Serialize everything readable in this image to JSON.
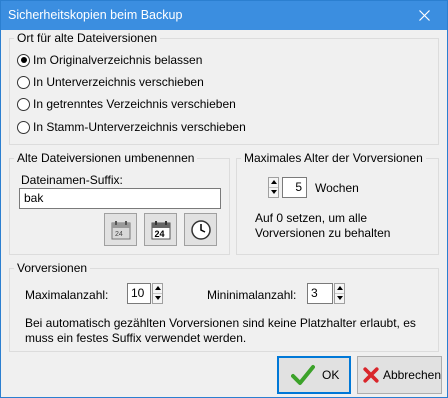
{
  "window": {
    "title": "Sicherheitskopien beim Backup"
  },
  "location_group": {
    "legend": "Ort für alte Dateiversionen",
    "options": [
      {
        "label": "Im Originalverzeichnis belassen",
        "checked": true
      },
      {
        "label": "In Unterverzeichnis verschieben",
        "checked": false
      },
      {
        "label": "In getrenntes Verzeichnis verschieben",
        "checked": false
      },
      {
        "label": "In Stamm-Unterverzeichnis verschieben",
        "checked": false
      }
    ]
  },
  "rename_group": {
    "legend": "Alte Dateiversionen umbenennen",
    "suffix_label": "Dateinamen-Suffix:",
    "suffix_value": "bak",
    "buttons": [
      {
        "icon": "calendar-icon"
      },
      {
        "icon": "calendar-24-icon",
        "text": "24"
      },
      {
        "icon": "clock-icon"
      }
    ]
  },
  "age_group": {
    "legend": "Maximales Alter der Vorversionen",
    "value": "5",
    "unit": "Wochen",
    "hint": "Auf 0 setzen, um alle Vorversionen zu behalten"
  },
  "versions_group": {
    "legend": "Vorversionen",
    "max_label": "Maximalanzahl:",
    "max_value": "10",
    "min_label": "Mininimalanzahl:",
    "min_value": "3",
    "note": "Bei automatisch gezählten Vorversionen sind keine Platzhalter erlaubt, es muss ein festes Suffix verwendet werden."
  },
  "buttons": {
    "ok": "OK",
    "cancel": "Abbrechen"
  },
  "colors": {
    "titlebar": "#3b8ee0",
    "ok_check": "#3ca22a",
    "cancel_x": "#d9262b"
  }
}
